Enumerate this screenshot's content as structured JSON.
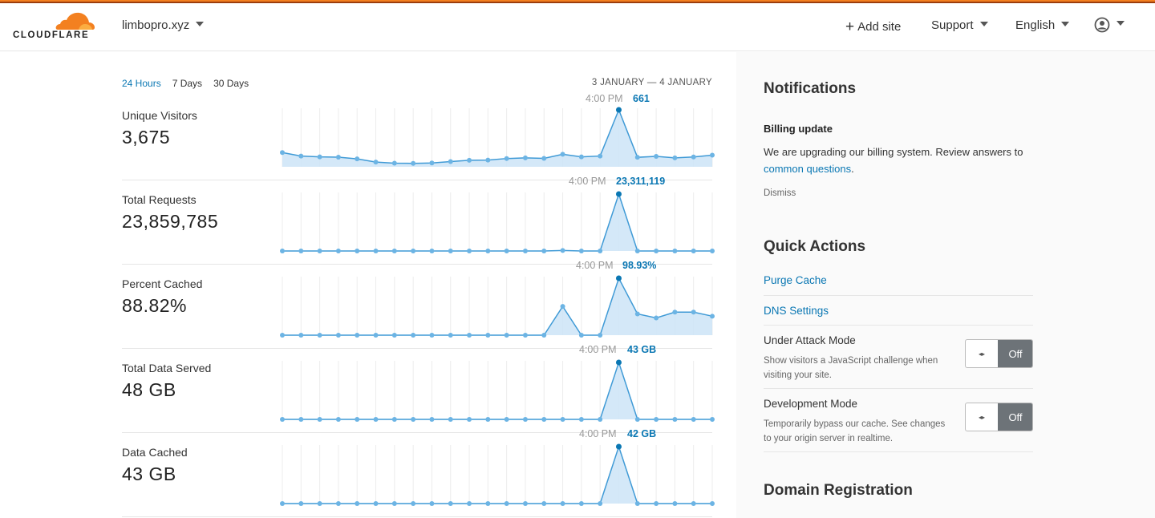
{
  "header": {
    "brand": "CLOUDFLARE",
    "site": "limbopro.xyz",
    "add_site": "Add site",
    "support": "Support",
    "language": "English",
    "account_icon": "user-circle-icon"
  },
  "analytics": {
    "periods": [
      "24 Hours",
      "7 Days",
      "30 Days"
    ],
    "active_period": "24 Hours",
    "date_range": "3 JANUARY — 4 JANUARY",
    "metrics": [
      {
        "label": "Unique Visitors",
        "value": "3,675",
        "peak_time": "4:00 PM",
        "peak_value": "661"
      },
      {
        "label": "Total Requests",
        "value": "23,859,785",
        "peak_time": "4:00 PM",
        "peak_value": "23,311,119"
      },
      {
        "label": "Percent Cached",
        "value": "88.82%",
        "peak_time": "4:00 PM",
        "peak_value": "98.93%"
      },
      {
        "label": "Total Data Served",
        "value": "48 GB",
        "peak_time": "4:00 PM",
        "peak_value": "43 GB"
      },
      {
        "label": "Data Cached",
        "value": "43 GB",
        "peak_time": "4:00 PM",
        "peak_value": "42 GB"
      }
    ]
  },
  "chart_data": [
    {
      "type": "area",
      "title": "Unique Visitors",
      "peak_index": 18,
      "values": [
        165,
        125,
        115,
        112,
        92,
        55,
        42,
        40,
        44,
        60,
        76,
        78,
        96,
        104,
        98,
        145,
        115,
        125,
        661,
        110,
        121,
        104,
        114,
        135
      ]
    },
    {
      "type": "area",
      "title": "Total Requests",
      "peak_index": 18,
      "values": [
        0,
        0,
        0,
        0,
        0,
        0,
        0,
        0,
        0,
        0,
        0,
        0,
        0,
        0,
        0,
        200000,
        0,
        0,
        23311119,
        0,
        0,
        0,
        0,
        0
      ]
    },
    {
      "type": "area",
      "title": "Percent Cached",
      "peak_index": 18,
      "values": [
        0,
        0,
        0,
        0,
        0,
        0,
        0,
        0,
        0,
        0,
        0,
        0,
        0,
        0,
        0,
        50,
        0,
        0,
        98.93,
        37,
        30,
        40,
        40,
        33
      ]
    },
    {
      "type": "area",
      "title": "Total Data Served",
      "peak_index": 18,
      "values": [
        0,
        0,
        0,
        0,
        0,
        0,
        0,
        0,
        0,
        0,
        0,
        0,
        0,
        0,
        0,
        0,
        0,
        0,
        43,
        0,
        0,
        0,
        0,
        0
      ]
    },
    {
      "type": "area",
      "title": "Data Cached",
      "peak_index": 18,
      "values": [
        0,
        0,
        0,
        0,
        0,
        0,
        0,
        0,
        0,
        0,
        0,
        0,
        0,
        0,
        0,
        0,
        0,
        0,
        42,
        0,
        0,
        0,
        0,
        0
      ]
    }
  ],
  "notifications": {
    "heading": "Notifications",
    "title": "Billing update",
    "text_before": "We are upgrading our billing system. Review answers to ",
    "link": "common questions",
    "text_after": ".",
    "dismiss": "Dismiss"
  },
  "quick_actions": {
    "heading": "Quick Actions",
    "purge_cache": "Purge Cache",
    "dns_settings": "DNS Settings",
    "under_attack": {
      "title": "Under Attack Mode",
      "desc": "Show visitors a JavaScript challenge when visiting your site.",
      "state": "Off"
    },
    "dev_mode": {
      "title": "Development Mode",
      "desc": "Temporarily bypass our cache. See changes to your origin server in realtime.",
      "state": "Off"
    }
  },
  "domain_registration": {
    "heading": "Domain Registration"
  },
  "colors": {
    "accent": "#0a77b3",
    "chart_line": "#3f9ad6",
    "chart_fill": "#cfe6f7",
    "brand_orange": "#f38020"
  }
}
